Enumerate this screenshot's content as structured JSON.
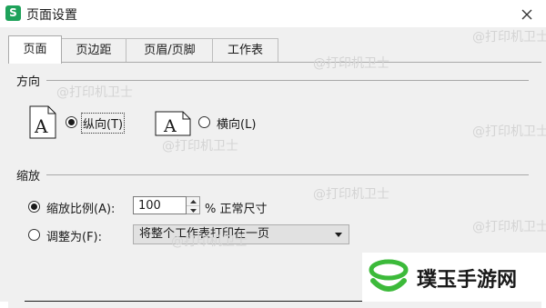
{
  "window": {
    "app_icon_letter": "S",
    "title": "页面设置"
  },
  "tabs": [
    {
      "label": "页面",
      "active": true
    },
    {
      "label": "页边距",
      "active": false
    },
    {
      "label": "页眉/页脚",
      "active": false
    },
    {
      "label": "工作表",
      "active": false
    }
  ],
  "orientation": {
    "group_title": "方向",
    "portrait_label": "纵向(T)",
    "landscape_label": "横向(L)",
    "selected": "portrait"
  },
  "scaling": {
    "group_title": "缩放",
    "scale_label": "缩放比例(A):",
    "scale_value": "100",
    "scale_unit": "% 正常尺寸",
    "fit_label": "调整为(F):",
    "fit_option": "将整个工作表打印在一页",
    "selected": "scale"
  },
  "watermarks": [
    "@打印机卫士",
    "@打印机卫士",
    "@打印机卫士",
    "@打印机卫士",
    "@打印机卫士",
    "@打印机卫士",
    "@打印机卫士",
    "@打印机卫士"
  ],
  "brand": {
    "name": "璞玉手游网"
  },
  "colors": {
    "app_icon": "#1ea25a",
    "dialog_bg": "#f0f0f0",
    "brand_green": "#3cba3a"
  }
}
